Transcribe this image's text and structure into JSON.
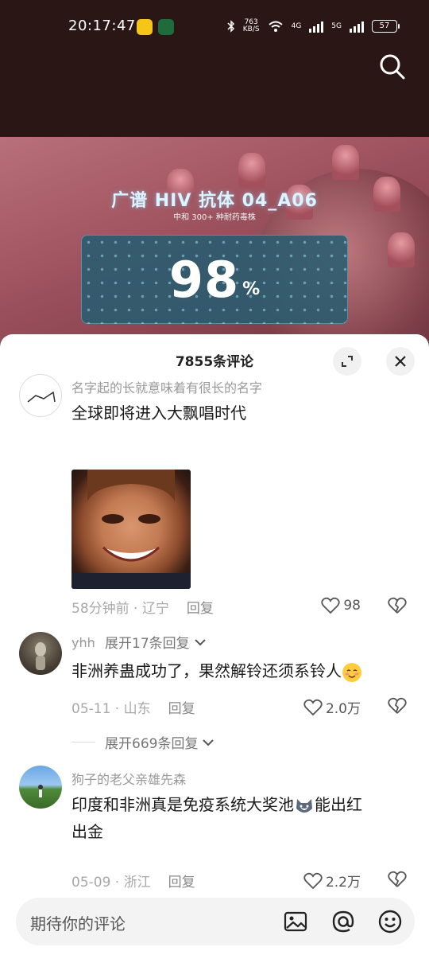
{
  "status_bar": {
    "time": "20:17:47",
    "speed_value": "763",
    "speed_unit": "KB/S",
    "net1": "4G",
    "net2": "5G",
    "battery": "57"
  },
  "hero": {
    "title": "广谱 HIV 抗体 04_A06",
    "subtitle": "中和 300+ 种耐药毒株",
    "percent_value": "98",
    "percent_unit": "%"
  },
  "sheet": {
    "title": "7855条评论"
  },
  "comments": [
    {
      "username": "名字起的长就意味着有很长的名字",
      "text": "全球即将进入大飘唱时代",
      "time_location": "58分钟前 · 辽宁",
      "reply_label": "回复",
      "likes": "98",
      "expand_label": "展开17条回复"
    },
    {
      "username": "yhh",
      "text": "非洲养蛊成功了，果然解铃还须系铃人",
      "time_location": "05-11 · 山东",
      "reply_label": "回复",
      "likes": "2.0万",
      "expand_label": "展开669条回复"
    },
    {
      "username": "狗子的老父亲雄先森",
      "text_line1": "印度和非洲真是免疫系统大奖池",
      "text_line1_end": "能出红",
      "text_line2": "出金",
      "time_location": "05-09 · 浙江",
      "reply_label": "回复",
      "likes": "2.2万"
    }
  ],
  "input": {
    "placeholder": "期待你的评论"
  },
  "icons": [
    "search-icon",
    "expand-icon",
    "close-icon",
    "heart-icon",
    "broken-heart-icon",
    "chevron-down-icon",
    "image-icon",
    "at-icon",
    "emoji-icon"
  ]
}
